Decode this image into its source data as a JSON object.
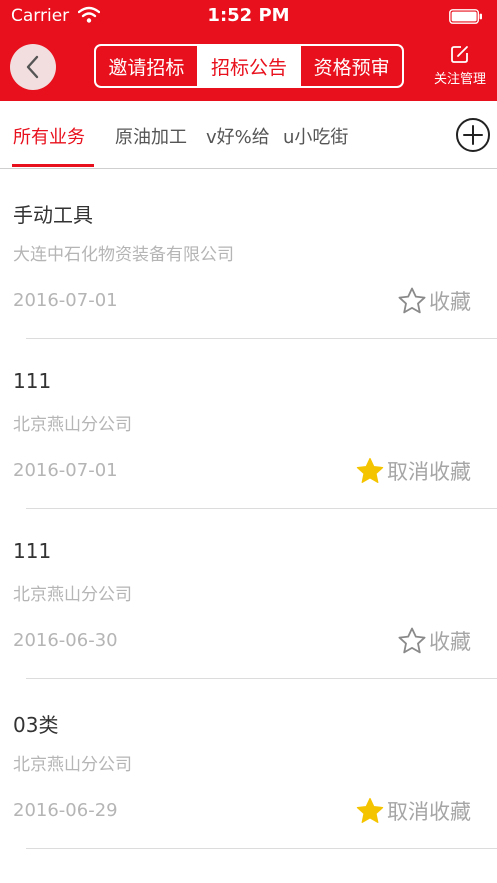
{
  "status_bar": {
    "carrier": "Carrier",
    "time": "1:52 PM"
  },
  "nav": {
    "segments": [
      {
        "label": "邀请招标",
        "active": false
      },
      {
        "label": "招标公告",
        "active": true
      },
      {
        "label": "资格预审",
        "active": false
      }
    ],
    "follow_label": "关注管理"
  },
  "tabs": [
    {
      "label": "所有业务",
      "active": true
    },
    {
      "label": "原油加工",
      "active": false
    },
    {
      "label": "v好%给",
      "active": false
    },
    {
      "label": "u小吃街",
      "active": false
    }
  ],
  "items": [
    {
      "title": "手动工具",
      "company": "大连中石化物资装备有限公司",
      "date": "2016-07-01",
      "fav_label": "收藏",
      "favorited": false
    },
    {
      "title": "111",
      "company": "北京燕山分公司",
      "date": "2016-07-01",
      "fav_label": "取消收藏",
      "favorited": true
    },
    {
      "title": "111",
      "company": "北京燕山分公司",
      "date": "2016-06-30",
      "fav_label": "收藏",
      "favorited": false
    },
    {
      "title": "03类",
      "company": "北京燕山分公司",
      "date": "2016-06-29",
      "fav_label": "取消收藏",
      "favorited": true
    }
  ],
  "colors": {
    "accent": "#e8101c",
    "star_filled": "#f5c400",
    "star_outline": "#8a8a8a"
  },
  "icons": {
    "back": "chevron-left-icon",
    "follow": "edit-icon",
    "add": "plus-circle-icon",
    "fav_on": "star-filled-icon",
    "fav_off": "star-outline-icon"
  }
}
